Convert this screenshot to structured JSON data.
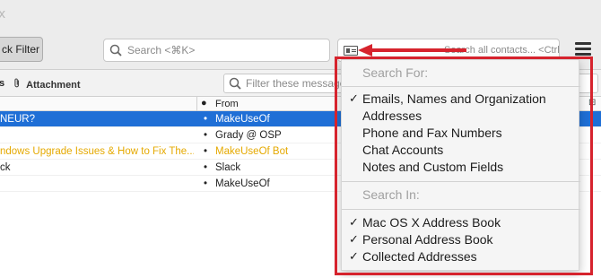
{
  "titlebar": {
    "close_glyph": "x"
  },
  "toolbar": {
    "quick_filter_label": "ck Filter",
    "search_placeholder": "Search <⌘K>",
    "contacts_placeholder": "Search all contacts... <Ctrl+Shift+E>"
  },
  "filterbar": {
    "prefix": "s",
    "attachment_label": "Attachment",
    "filter_placeholder": "Filter these messages"
  },
  "columns": {
    "dot": "●",
    "from": "From",
    "picker_glyph": "⊞"
  },
  "messages": [
    {
      "subject": "NEUR?",
      "from": "MakeUseOf"
    },
    {
      "subject": "",
      "from": "Grady @ OSP"
    },
    {
      "subject": "ndows Upgrade Issues & How to Fix The...",
      "from": "MakeUseOf Bot"
    },
    {
      "subject": "ck",
      "from": "Slack"
    },
    {
      "subject": "",
      "from": "MakeUseOf"
    }
  ],
  "dropdown": {
    "search_for_heading": "Search For:",
    "search_for_items": [
      {
        "label": "Emails, Names and Organization",
        "checked": true
      },
      {
        "label": "Addresses",
        "checked": false
      },
      {
        "label": "Phone and Fax Numbers",
        "checked": false
      },
      {
        "label": "Chat Accounts",
        "checked": false
      },
      {
        "label": "Notes and Custom Fields",
        "checked": false
      }
    ],
    "search_in_heading": "Search In:",
    "search_in_items": [
      {
        "label": "Mac OS X Address Book",
        "checked": true
      },
      {
        "label": "Personal Address Book",
        "checked": true
      },
      {
        "label": "Collected Addresses",
        "checked": true
      }
    ]
  },
  "colors": {
    "selection": "#1f6fd6",
    "annotation": "#d6232d",
    "bot_sender": "#e5a900"
  }
}
